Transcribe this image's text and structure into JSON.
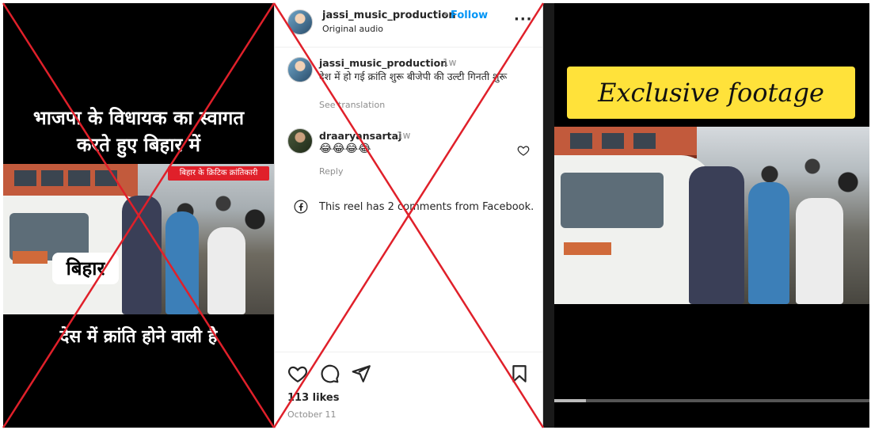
{
  "left_panel": {
    "headline_line1": "भाजपा के विधायक का स्वागत",
    "headline_line2": "करते हुए बिहार में",
    "video_tag": "बिहार के क्रिटिक क्रांतिकारी",
    "location_label": "बिहार",
    "bottom_caption": "देस में क्रांति होने वाली है"
  },
  "post": {
    "header": {
      "username": "jassi_music_production",
      "separator": "•",
      "follow_label": "Follow",
      "audio_label": "Original audio",
      "more_icon": "more-options-icon"
    },
    "comments": [
      {
        "username": "jassi_music_production",
        "time": "1w",
        "text": "देश में हो गई क्रांति शुरू बीजेपी की उल्टी गिनती शुरू",
        "see_translation": "See translation"
      },
      {
        "username": "draaryansartaj",
        "time": "1w",
        "text": "😂😂😂😂",
        "reply": "Reply"
      }
    ],
    "facebook_note": "This reel has 2 comments from Facebook.",
    "likes": "113 likes",
    "date": "October 11"
  },
  "right_panel": {
    "banner_text": "Exclusive footage"
  },
  "colors": {
    "follow_blue": "#0095f6",
    "cross_red": "#e0202a",
    "banner_yellow": "#ffe23a"
  }
}
